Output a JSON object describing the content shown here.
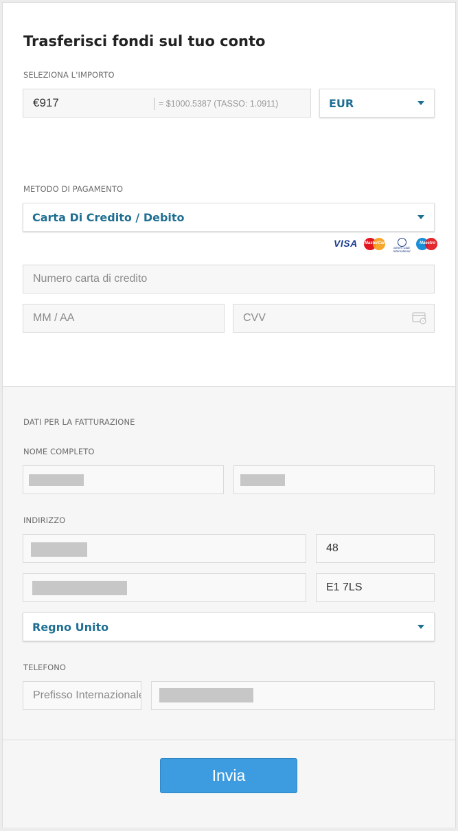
{
  "header": {
    "title": "Trasferisci fondi sul tuo conto"
  },
  "amount": {
    "label": "SELEZIONA L'IMPORTO",
    "value": "€917",
    "conversion": "= $1000.5387   (TASSO: 1.0911)",
    "currency": "EUR"
  },
  "payment": {
    "label": "METODO DI PAGAMENTO",
    "method": "Carta Di Credito / Debito",
    "card_brands": [
      "VISA",
      "MasterCard",
      "Diners Club International",
      "Maestro"
    ],
    "card_number_placeholder": "Numero carta di credito",
    "expiry_placeholder": "MM / AA",
    "cvv_placeholder": "CVV"
  },
  "billing": {
    "section_label": "DATI PER LA FATTURAZIONE",
    "name_label": "NOME COMPLETO",
    "address_label": "INDIRIZZO",
    "house_number": "48",
    "postcode": "E1 7LS",
    "country": "Regno Unito",
    "phone_label": "TELEFONO",
    "phone_prefix_placeholder": "Prefisso Internazionale"
  },
  "footer": {
    "submit_label": "Invia"
  },
  "colors": {
    "accent": "#1f6f93",
    "submit": "#3d9be0"
  }
}
